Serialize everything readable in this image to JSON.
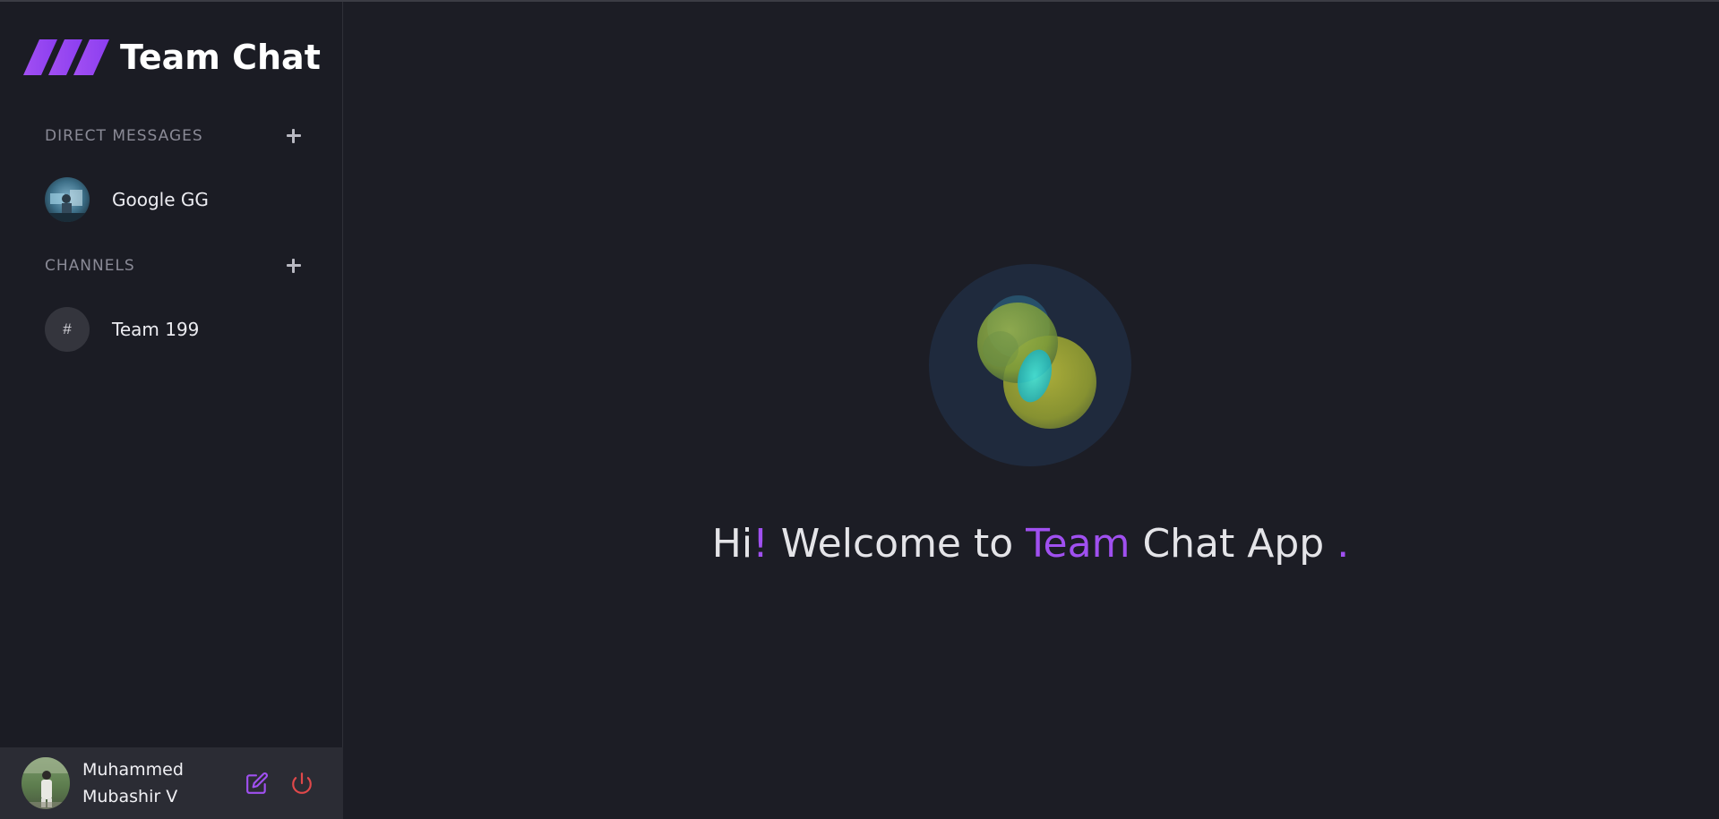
{
  "app": {
    "title": "Team Chat",
    "accent_color": "#a050f0",
    "background_color": "#1c1d25"
  },
  "sidebar": {
    "direct_messages": {
      "title": "DIRECT MESSAGES",
      "items": [
        {
          "label": "Google GG",
          "avatar": "user-photo"
        }
      ]
    },
    "channels": {
      "title": "CHANNELS",
      "items": [
        {
          "label": "Team 199",
          "icon_text": "#"
        }
      ]
    }
  },
  "user": {
    "first_line": "Muhammed",
    "second_line": "Mubashir V",
    "edit_icon": "edit-icon",
    "power_icon": "power-icon",
    "edit_color": "#a050f0",
    "power_color": "#e0484a"
  },
  "welcome": {
    "part1": "Hi",
    "excl": "!",
    "part2": " Welcome to ",
    "team": "Team",
    "part3": " Chat App ",
    "dot": "."
  }
}
